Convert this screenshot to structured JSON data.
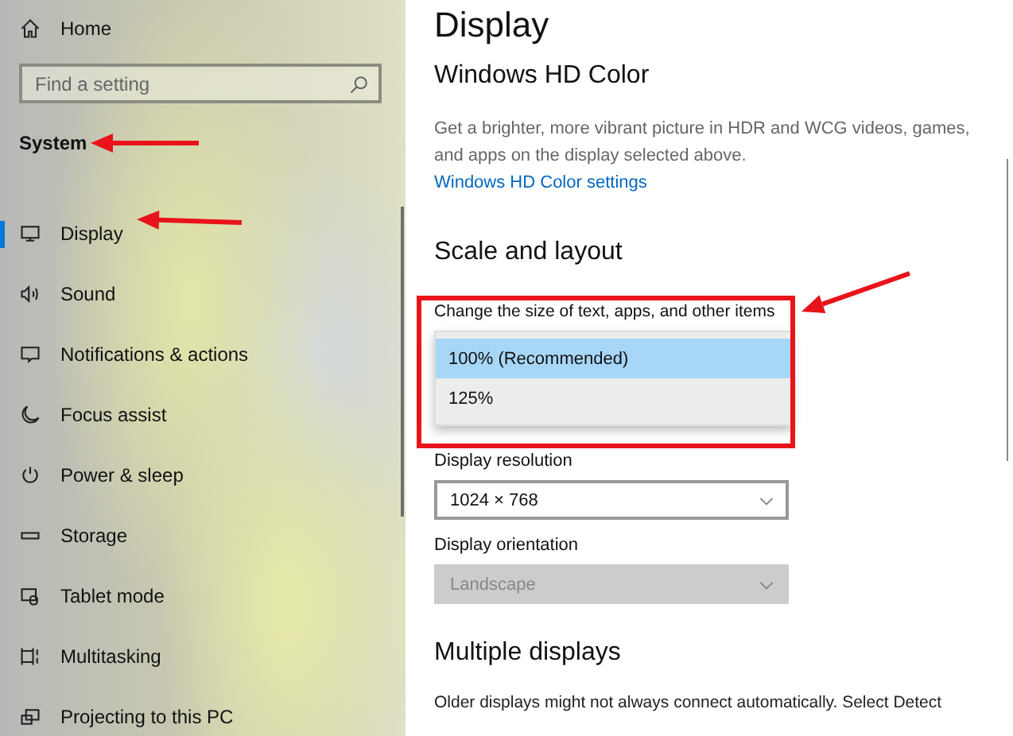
{
  "sidebar": {
    "home": {
      "label": "Home"
    },
    "search": {
      "placeholder": "Find a setting"
    },
    "section_title": "System",
    "items": [
      {
        "label": "Display",
        "selected": true
      },
      {
        "label": "Sound",
        "selected": false
      },
      {
        "label": "Notifications & actions",
        "selected": false
      },
      {
        "label": "Focus assist",
        "selected": false
      },
      {
        "label": "Power & sleep",
        "selected": false
      },
      {
        "label": "Storage",
        "selected": false
      },
      {
        "label": "Tablet mode",
        "selected": false
      },
      {
        "label": "Multitasking",
        "selected": false
      },
      {
        "label": "Projecting to this PC",
        "selected": false
      }
    ]
  },
  "main": {
    "title": "Display",
    "hd_color": {
      "heading": "Windows HD Color",
      "description": "Get a brighter, more vibrant picture in HDR and WCG videos, games, and apps on the display selected above.",
      "link": "Windows HD Color settings"
    },
    "scale": {
      "heading": "Scale and layout",
      "size_label": "Change the size of text, apps, and other items",
      "size_options": [
        {
          "label": "100% (Recommended)",
          "selected": true
        },
        {
          "label": "125%",
          "selected": false
        }
      ],
      "resolution_label": "Display resolution",
      "resolution": {
        "value": "1024 × 768",
        "disabled": false
      },
      "orientation_label": "Display orientation",
      "orientation": {
        "value": "Landscape",
        "disabled": true
      }
    },
    "multiple": {
      "heading": "Multiple displays",
      "description": "Older displays might not always connect automatically. Select Detect"
    }
  }
}
